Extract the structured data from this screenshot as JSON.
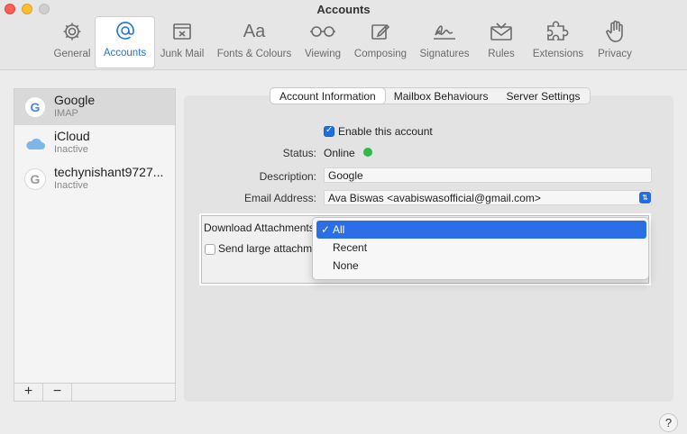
{
  "window": {
    "title": "Accounts"
  },
  "toolbar": {
    "tabs": [
      {
        "label": "General",
        "icon": "gear-icon"
      },
      {
        "label": "Accounts",
        "icon": "at-sign-icon"
      },
      {
        "label": "Junk Mail",
        "icon": "junk-tray-icon"
      },
      {
        "label": "Fonts & Colours",
        "icon": "font-aa-icon"
      },
      {
        "label": "Viewing",
        "icon": "glasses-icon"
      },
      {
        "label": "Composing",
        "icon": "compose-icon"
      },
      {
        "label": "Signatures",
        "icon": "signature-icon"
      },
      {
        "label": "Rules",
        "icon": "envelope-rules-icon"
      },
      {
        "label": "Extensions",
        "icon": "puzzle-icon"
      },
      {
        "label": "Privacy",
        "icon": "hand-icon"
      }
    ],
    "active": "Accounts"
  },
  "sidebar": {
    "accounts": [
      {
        "name": "Google",
        "status": "IMAP",
        "icon": "google-icon"
      },
      {
        "name": "iCloud",
        "status": "Inactive",
        "icon": "cloud-icon"
      },
      {
        "name": "techynishant9727...",
        "status": "Inactive",
        "icon": "google-icon"
      }
    ],
    "add_label": "+",
    "remove_label": "−"
  },
  "segments": [
    "Account Information",
    "Mailbox Behaviours",
    "Server Settings"
  ],
  "form": {
    "enable_label": "Enable this account",
    "status_label": "Status:",
    "status_value": "Online",
    "description_label": "Description:",
    "description_value": "Google",
    "email_label": "Email Address:",
    "email_value": "Ava Biswas <avabiswasofficial@gmail.com>",
    "download_label": "Download Attachments",
    "send_large_label": "Send large attachm",
    "download_options": [
      "All",
      "Recent",
      "None"
    ],
    "check_mark": "✓"
  },
  "help_label": "?"
}
